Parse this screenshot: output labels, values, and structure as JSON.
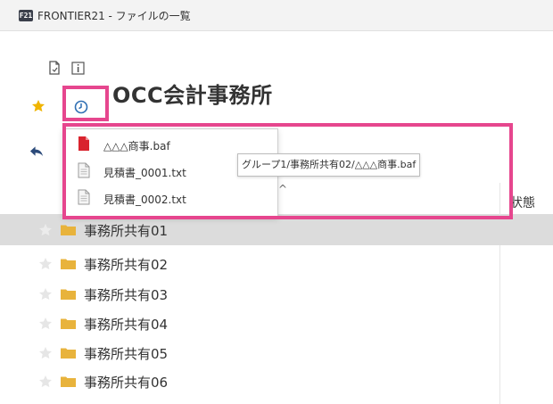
{
  "window": {
    "app_badge": "F21",
    "title": "FRONTIER21 - ファイルの一覧"
  },
  "toolbar": {
    "company_name": "OCC会計事務所"
  },
  "recent_menu": {
    "items": [
      {
        "label": "△△△商事.baf",
        "icon": "baf-file-icon"
      },
      {
        "label": "見積書_0001.txt",
        "icon": "text-file-icon"
      },
      {
        "label": "見積書_0002.txt",
        "icon": "text-file-icon"
      }
    ],
    "tooltip": "グループ1/事務所共有02/△△△商事.baf"
  },
  "list": {
    "status_header": "状態",
    "rows": [
      {
        "name": "事務所共有01",
        "selected": true
      },
      {
        "name": "事務所共有02",
        "selected": false
      },
      {
        "name": "事務所共有03",
        "selected": false
      },
      {
        "name": "事務所共有04",
        "selected": false
      },
      {
        "name": "事務所共有05",
        "selected": false
      },
      {
        "name": "事務所共有06",
        "selected": false
      }
    ]
  },
  "colors": {
    "highlight": "#e6468e",
    "star_active": "#f0b400",
    "folder": "#e8b33c",
    "clock": "#2f6fb3"
  }
}
